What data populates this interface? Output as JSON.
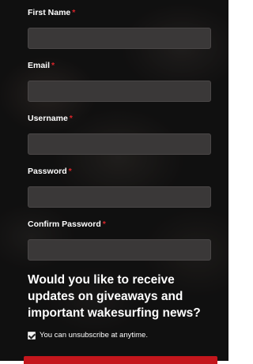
{
  "colors": {
    "required_marker": "#d9242a",
    "input_background": "#3a3838",
    "submit_button": "#c4161c"
  },
  "form": {
    "required_marker": "*",
    "fields": [
      {
        "label": "First Name",
        "value": "",
        "type": "text"
      },
      {
        "label": "Email",
        "value": "",
        "type": "email"
      },
      {
        "label": "Username",
        "value": "",
        "type": "text"
      },
      {
        "label": "Password",
        "value": "",
        "type": "password"
      },
      {
        "label": "Confirm Password",
        "value": "",
        "type": "password"
      }
    ],
    "question": "Would you like to receive updates on giveaways and important wakesurfing news?",
    "consent": {
      "checked": true,
      "label": "You can unsubscribe at anytime."
    }
  }
}
